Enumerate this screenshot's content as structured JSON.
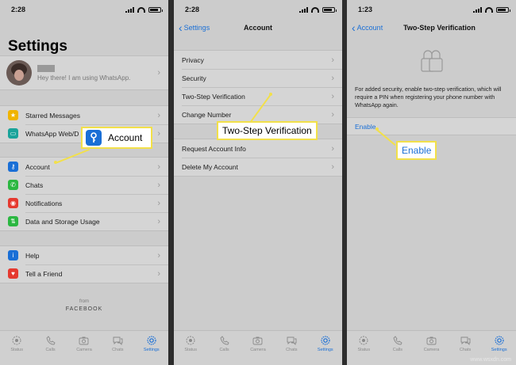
{
  "colors": {
    "accent": "#1a6fd6",
    "callout_border": "#f2e04a"
  },
  "screen1": {
    "time": "2:28",
    "title": "Settings",
    "profile_status": "Hey there! I am using WhatsApp.",
    "group1": [
      {
        "icon": "star-icon",
        "color": "#f0b400",
        "label": "Starred Messages"
      },
      {
        "icon": "laptop-icon",
        "color": "#1aa39a",
        "label": "WhatsApp Web/D"
      }
    ],
    "group2": [
      {
        "icon": "key-icon",
        "color": "#1a6fd6",
        "label": "Account"
      },
      {
        "icon": "whatsapp-icon",
        "color": "#2bb741",
        "label": "Chats"
      },
      {
        "icon": "bell-icon",
        "color": "#e5392f",
        "label": "Notifications"
      },
      {
        "icon": "data-icon",
        "color": "#2bb741",
        "label": "Data and Storage Usage"
      }
    ],
    "group3": [
      {
        "icon": "info-icon",
        "color": "#1a6fd6",
        "label": "Help"
      },
      {
        "icon": "heart-icon",
        "color": "#e5392f",
        "label": "Tell a Friend"
      }
    ],
    "footer_from": "from",
    "footer_brand": "FACEBOOK",
    "callout": "Account"
  },
  "screen2": {
    "time": "2:28",
    "back_label": "Settings",
    "title": "Account",
    "group1": [
      "Privacy",
      "Security",
      "Two-Step Verification",
      "Change Number"
    ],
    "group2": [
      "Request Account Info",
      "Delete My Account"
    ],
    "callout": "Two-Step Verification"
  },
  "screen3": {
    "time": "1:23",
    "back_label": "Account",
    "title": "Two-Step Verification",
    "description": "For added security, enable two-step verification, which will require a PIN when registering your phone number with WhatsApp again.",
    "enable_label": "Enable",
    "callout": "Enable"
  },
  "tabs": [
    {
      "label": "Status",
      "icon": "status-icon"
    },
    {
      "label": "Calls",
      "icon": "phone-icon"
    },
    {
      "label": "Camera",
      "icon": "camera-icon"
    },
    {
      "label": "Chats",
      "icon": "chats-icon"
    },
    {
      "label": "Settings",
      "icon": "settings-icon"
    }
  ],
  "watermark": "www.wsxdn.com"
}
